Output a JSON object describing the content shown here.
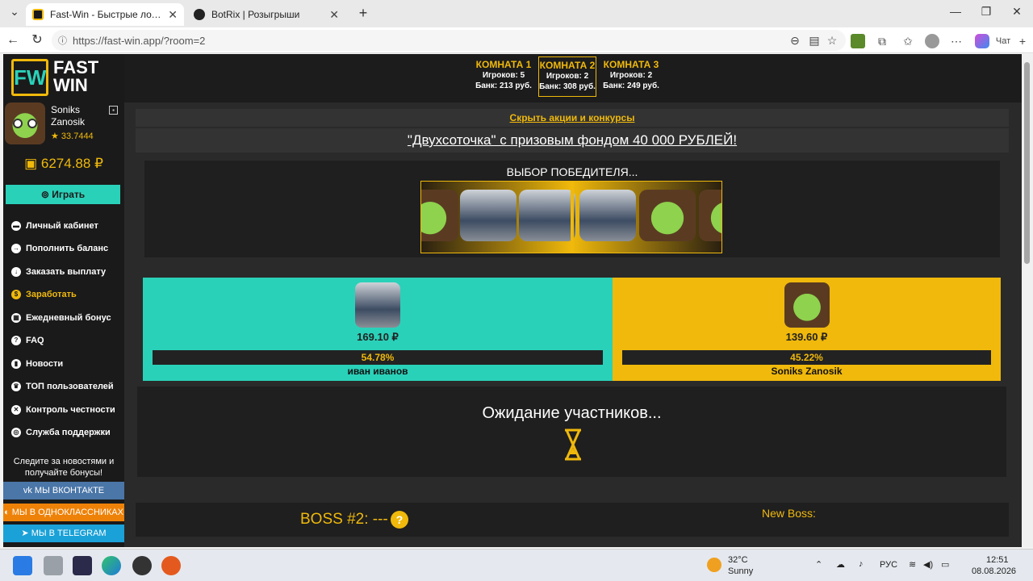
{
  "browser": {
    "tabs": [
      {
        "title": "Fast-Win - Быстрые лотереи! Ком",
        "active": true
      },
      {
        "title": "BotRix | Розыгрыши",
        "active": false
      }
    ],
    "url": "https://fast-win.app/?room=2",
    "chat_label": "Чат"
  },
  "rooms": [
    {
      "name": "КОМНАТА 1",
      "players": "Игроков: 5",
      "bank": "Банк: 213 руб."
    },
    {
      "name": "КОМНАТА 2",
      "players": "Игроков: 2",
      "bank": "Банк: 308 руб."
    },
    {
      "name": "КОМНАТА 3",
      "players": "Игроков: 2",
      "bank": "Банк: 249 руб."
    }
  ],
  "sidebar": {
    "logo_fw": "FW",
    "logo_fast": "FAST",
    "logo_win": "WIN",
    "user_name": "Soniks Zanosik",
    "rating": "★ 33.7444",
    "balance": "6274.88 ₽",
    "play": "Играть",
    "menu": [
      "Личный кабинет",
      "Пополнить баланс",
      "Заказать выплату",
      "Заработать",
      "Ежедневный бонус",
      "FAQ",
      "Новости",
      "ТОП пользователей",
      "Контроль честности",
      "Служба поддержки"
    ],
    "follow": "Следите за новостями и получайте бонусы!",
    "social": [
      "МЫ ВКОНТАКТЕ",
      "МЫ В ОДНОКЛАССНИКАХ",
      "МЫ В TELEGRAM"
    ]
  },
  "main": {
    "hide_promos": "Скрыть акции и конкурсы",
    "contest": "\"Двухсоточка\" с призовым фондом 40 000 РУБЛЕЙ!",
    "picking": "ВЫБОР ПОБЕДИТЕЛЯ...",
    "players": [
      {
        "amount": "169.10 ₽",
        "percent": "54.78%",
        "share": 0.5478,
        "name": "иван иванов",
        "color": "#2ad1b9"
      },
      {
        "amount": "139.60 ₽",
        "percent": "45.22%",
        "share": 0.4522,
        "name": "Soniks Zanosik",
        "color": "#f0b90b"
      }
    ],
    "waiting": "Ожидание участников...",
    "boss": "BOSS #2: ---",
    "boss_q": "?",
    "new_boss": "New Boss:"
  },
  "taskbar": {
    "temp": "32°C",
    "weather": "Sunny",
    "lang": "РУС",
    "time": "12:51",
    "date": "08.08.2026"
  }
}
